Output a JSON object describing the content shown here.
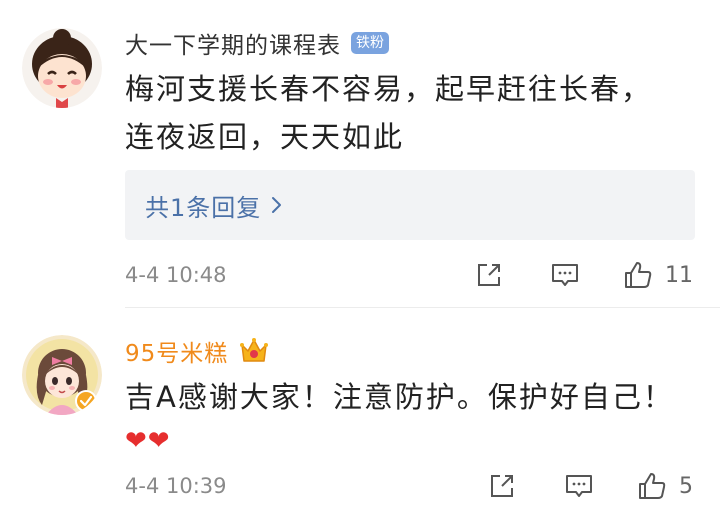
{
  "comments": [
    {
      "username": "大一下学期的课程表",
      "badge": "铁粉",
      "text_line1": "梅河支援长春不容易，起早赶往长春，",
      "text_line2": "连夜返回，天天如此",
      "reply_summary": "共1条回复",
      "reply_chevron": "›",
      "time": "4-4 10:48",
      "likes": "11",
      "avatar_icon": "cartoon-girl-avatar",
      "badge_color": "#7aa3df"
    },
    {
      "username": "95号米糕",
      "username_color": "#f08a1b",
      "vip_icon": "crown-icon",
      "text": "吉A感谢大家！注意防护。保护好自己！",
      "hearts": "❤❤",
      "time": "4-4 10:39",
      "likes": "5",
      "avatar_icon": "anime-girl-avatar"
    }
  ]
}
